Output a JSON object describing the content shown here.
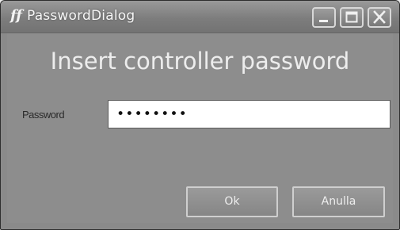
{
  "window": {
    "title": "PasswordDialog",
    "app_icon_glyph": "ff",
    "controls": {
      "minimize_icon": "minimize-icon",
      "maximize_icon": "maximize-icon",
      "close_icon": "close-icon"
    }
  },
  "dialog": {
    "heading": "Insert controller password",
    "password_label": "Password",
    "password_value": "••••••••",
    "ok_label": "Ok",
    "cancel_label": "Anulla"
  },
  "colors": {
    "titlebar": "#7d7d7d",
    "client_background": "#8d8d8d",
    "heading_text": "#ededed",
    "input_background": "#ffffff"
  }
}
